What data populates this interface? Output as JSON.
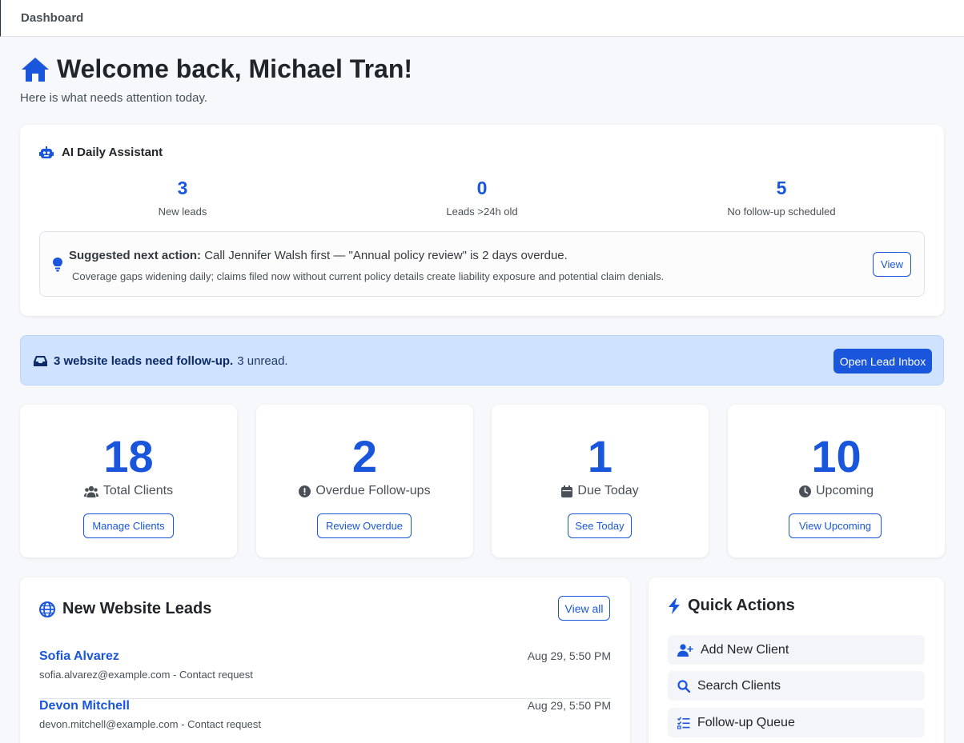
{
  "topbar": {
    "title": "Dashboard"
  },
  "greeting": {
    "title": "Welcome back, Michael Tran!",
    "subtitle": "Here is what needs attention today."
  },
  "assistant": {
    "title": "AI Daily Assistant",
    "stats": [
      {
        "value": "3",
        "label": "New leads"
      },
      {
        "value": "0",
        "label": "Leads >24h old"
      },
      {
        "value": "5",
        "label": "No follow-up scheduled"
      }
    ],
    "suggestion": {
      "prefix": "Suggested next action:",
      "text": "Call Jennifer Walsh first — \"Annual policy review\" is 2 days overdue.",
      "detail": "Coverage gaps widening daily; claims filed now without current policy details create liability exposure and potential claim denials.",
      "button": "View"
    }
  },
  "alert": {
    "bold": "3 website leads need follow-up.",
    "rest": "3 unread.",
    "button": "Open Lead Inbox"
  },
  "metrics": [
    {
      "value": "18",
      "label": "Total Clients",
      "icon": "users-icon",
      "button": "Manage Clients"
    },
    {
      "value": "2",
      "label": "Overdue Follow-ups",
      "icon": "exclamation-circle-icon",
      "button": "Review Overdue"
    },
    {
      "value": "1",
      "label": "Due Today",
      "icon": "calendar-icon",
      "button": "See Today"
    },
    {
      "value": "10",
      "label": "Upcoming",
      "icon": "clock-icon",
      "button": "View Upcoming"
    }
  ],
  "leads": {
    "title": "New Website Leads",
    "button": "View all",
    "items": [
      {
        "name": "Sofia Alvarez",
        "date": "Aug 29, 5:50 PM",
        "info": "sofia.alvarez@example.com - Contact request"
      },
      {
        "name": "Devon Mitchell",
        "date": "Aug 29, 5:50 PM",
        "info": "devon.mitchell@example.com - Contact request"
      }
    ]
  },
  "quick_actions": {
    "title": "Quick Actions",
    "items": [
      {
        "label": "Add New Client",
        "icon": "user-plus-icon"
      },
      {
        "label": "Search Clients",
        "icon": "search-icon"
      },
      {
        "label": "Follow-up Queue",
        "icon": "list-check-icon"
      }
    ]
  },
  "colors": {
    "accent": "#1a56db",
    "alert_bg": "#cfe2ff",
    "background": "#f6f8fb"
  }
}
